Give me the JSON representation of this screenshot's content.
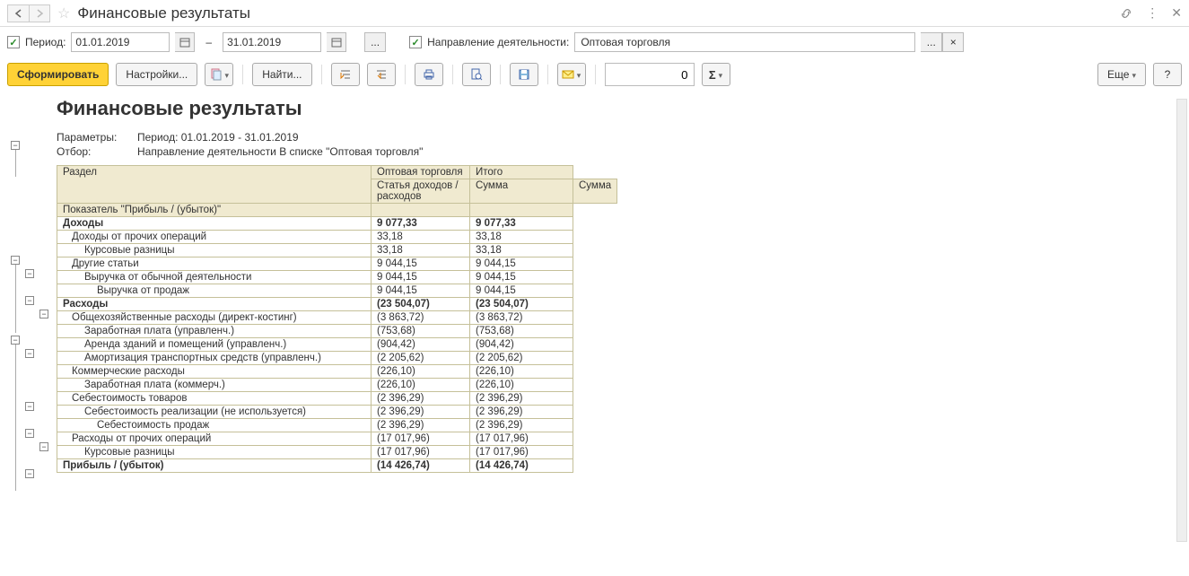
{
  "header": {
    "title": "Финансовые результаты"
  },
  "filter": {
    "period_label": "Период:",
    "date_from": "01.01.2019",
    "date_to": "31.01.2019",
    "activity_label": "Направление деятельности:",
    "activity_value": "Оптовая торговля",
    "dots": "...",
    "x": "×",
    "dash": "–"
  },
  "toolbar": {
    "generate": "Сформировать",
    "settings": "Настройки...",
    "find": "Найти...",
    "number_value": "0",
    "more": "Еще",
    "help": "?"
  },
  "report": {
    "title": "Финансовые результаты",
    "params_label": "Параметры:",
    "params_value": "Период: 01.01.2019 - 31.01.2019",
    "filter_label": "Отбор:",
    "filter_value": "Направление деятельности В списке \"Оптовая торговля\"",
    "headers": {
      "section": "Раздел",
      "col1": "Оптовая торговля",
      "total": "Итого",
      "article": "Статья доходов / расходов",
      "sum": "Сумма",
      "indicator": "Показатель \"Прибыль / (убыток)\""
    },
    "rows": [
      {
        "label": "Доходы",
        "v1": "9 077,33",
        "v2": "9 077,33",
        "bold": true,
        "indent": 0
      },
      {
        "label": "Доходы от прочих операций",
        "v1": "33,18",
        "v2": "33,18",
        "indent": 1
      },
      {
        "label": "Курсовые разницы",
        "v1": "33,18",
        "v2": "33,18",
        "indent": 2
      },
      {
        "label": "Другие статьи",
        "v1": "9 044,15",
        "v2": "9 044,15",
        "indent": 1
      },
      {
        "label": "Выручка от обычной деятельности",
        "v1": "9 044,15",
        "v2": "9 044,15",
        "indent": 2
      },
      {
        "label": "Выручка от продаж",
        "v1": "9 044,15",
        "v2": "9 044,15",
        "indent": 3
      },
      {
        "label": "Расходы",
        "v1": "(23 504,07)",
        "v2": "(23 504,07)",
        "bold": true,
        "indent": 0
      },
      {
        "label": "Общехозяйственные расходы (директ-костинг)",
        "v1": "(3 863,72)",
        "v2": "(3 863,72)",
        "indent": 1
      },
      {
        "label": "Заработная плата (управленч.)",
        "v1": "(753,68)",
        "v2": "(753,68)",
        "indent": 2
      },
      {
        "label": "Аренда зданий и помещений (управленч.)",
        "v1": "(904,42)",
        "v2": "(904,42)",
        "indent": 2
      },
      {
        "label": "Амортизация транспортных средств (управленч.)",
        "v1": "(2 205,62)",
        "v2": "(2 205,62)",
        "indent": 2
      },
      {
        "label": "Коммерческие расходы",
        "v1": "(226,10)",
        "v2": "(226,10)",
        "indent": 1
      },
      {
        "label": "Заработная плата (коммерч.)",
        "v1": "(226,10)",
        "v2": "(226,10)",
        "indent": 2
      },
      {
        "label": "Себестоимость товаров",
        "v1": "(2 396,29)",
        "v2": "(2 396,29)",
        "indent": 1
      },
      {
        "label": "Себестоимость реализации (не используется)",
        "v1": "(2 396,29)",
        "v2": "(2 396,29)",
        "indent": 2
      },
      {
        "label": "Себестоимость продаж",
        "v1": "(2 396,29)",
        "v2": "(2 396,29)",
        "indent": 3
      },
      {
        "label": "Расходы от прочих операций",
        "v1": "(17 017,96)",
        "v2": "(17 017,96)",
        "indent": 1
      },
      {
        "label": "Курсовые разницы",
        "v1": "(17 017,96)",
        "v2": "(17 017,96)",
        "indent": 2
      },
      {
        "label": "Прибыль / (убыток)",
        "v1": "(14 426,74)",
        "v2": "(14 426,74)",
        "bold": true,
        "indent": 0
      }
    ]
  }
}
